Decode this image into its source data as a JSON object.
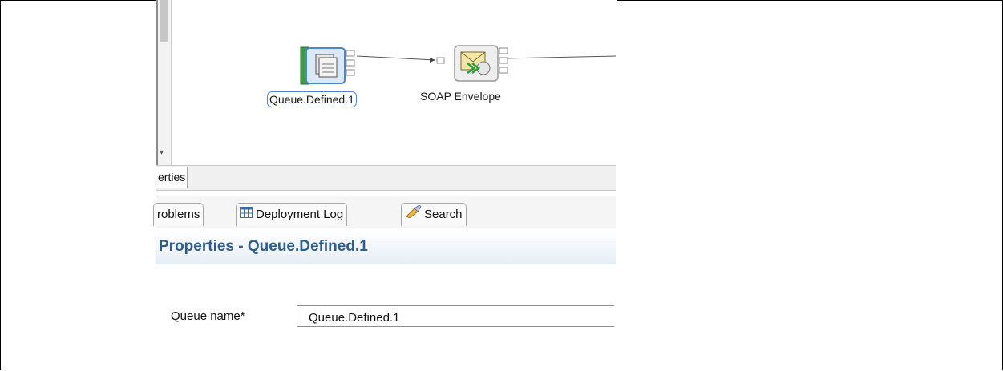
{
  "flow": {
    "nodes": [
      {
        "label": "Queue.Defined.1",
        "icon": "queue-icon",
        "selected": true
      },
      {
        "label": "SOAP Envelope",
        "icon": "soap-envelope-icon",
        "selected": false
      }
    ]
  },
  "tabs_top": [
    {
      "label": "erties"
    }
  ],
  "tabs_bottom": [
    {
      "label": "roblems",
      "icon": ""
    },
    {
      "label": "Deployment Log",
      "icon": "table-icon"
    },
    {
      "label": "Search",
      "icon": "flashlight-icon"
    }
  ],
  "properties": {
    "title": "Properties - Queue.Defined.1",
    "queue_name_label": "Queue name*",
    "queue_name_value": "Queue.Defined.1"
  },
  "colors": {
    "title": "#2b5d8f",
    "selection": "#4f86c6"
  }
}
